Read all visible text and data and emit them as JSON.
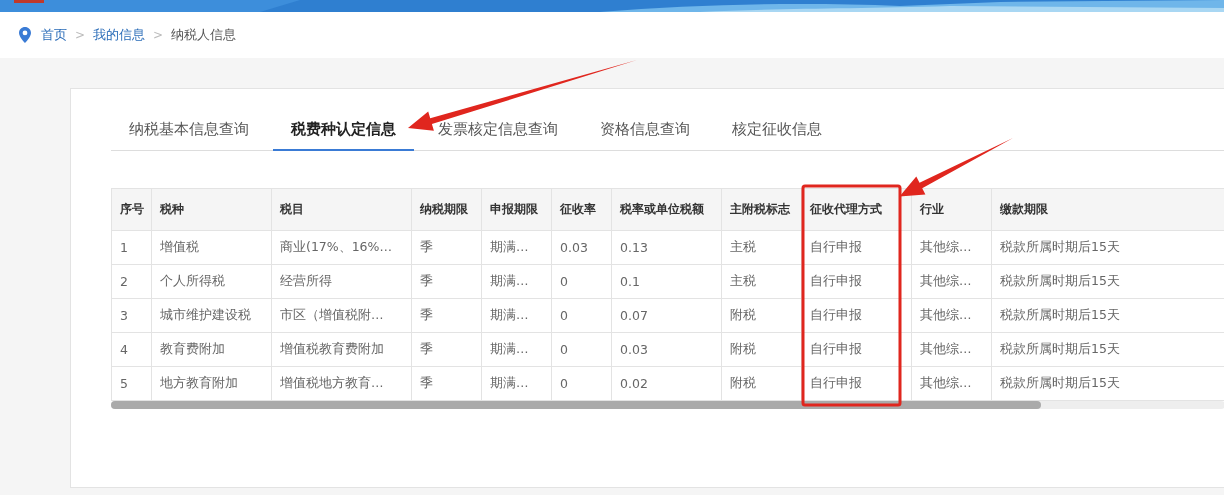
{
  "breadcrumb": [
    {
      "label": "首页",
      "kind": "link"
    },
    {
      "label": ">",
      "kind": "separator"
    },
    {
      "label": "我的信息",
      "kind": "link"
    },
    {
      "label": ">",
      "kind": "separator"
    },
    {
      "label": "纳税人信息",
      "kind": "current"
    }
  ],
  "tabs": [
    {
      "label": "纳税基本信息查询",
      "selected": false,
      "marked": false
    },
    {
      "label": "税费种认定信息",
      "selected": true,
      "marked": true
    },
    {
      "label": "发票核定信息查询",
      "selected": false,
      "marked": false
    },
    {
      "label": "资格信息查询",
      "selected": false,
      "marked": false
    },
    {
      "label": "核定征收信息",
      "selected": false,
      "marked": false
    }
  ],
  "table": {
    "columns": [
      {
        "label": "序号",
        "highlighted": false
      },
      {
        "label": "税种",
        "highlighted": false
      },
      {
        "label": "税目",
        "highlighted": false
      },
      {
        "label": "纳税期限",
        "highlighted": false
      },
      {
        "label": "申报期限",
        "highlighted": false
      },
      {
        "label": "征收率",
        "highlighted": false
      },
      {
        "label": "税率或单位税额",
        "highlighted": false
      },
      {
        "label": "主附税标志",
        "highlighted": false
      },
      {
        "label": "征收代理方式",
        "highlighted": true
      },
      {
        "label": "行业",
        "highlighted": false
      },
      {
        "label": "缴款期限",
        "highlighted": false
      }
    ],
    "rows": [
      [
        "1",
        "增值税",
        "商业(17%、16%…",
        "季",
        "期满…",
        "0.03",
        "0.13",
        "主税",
        "自行申报",
        "其他综…",
        "税款所属时期后15天"
      ],
      [
        "2",
        "个人所得税",
        "经营所得",
        "季",
        "期满…",
        "0",
        "0.1",
        "主税",
        "自行申报",
        "其他综…",
        "税款所属时期后15天"
      ],
      [
        "3",
        "城市维护建设税",
        "市区（增值税附…",
        "季",
        "期满…",
        "0",
        "0.07",
        "附税",
        "自行申报",
        "其他综…",
        "税款所属时期后15天"
      ],
      [
        "4",
        "教育费附加",
        "增值税教育费附加",
        "季",
        "期满…",
        "0",
        "0.03",
        "附税",
        "自行申报",
        "其他综…",
        "税款所属时期后15天"
      ],
      [
        "5",
        "地方教育附加",
        "增值税地方教育…",
        "季",
        "期满…",
        "0",
        "0.02",
        "附税",
        "自行申报",
        "其他综…",
        "税款所属时期后15天"
      ]
    ]
  }
}
